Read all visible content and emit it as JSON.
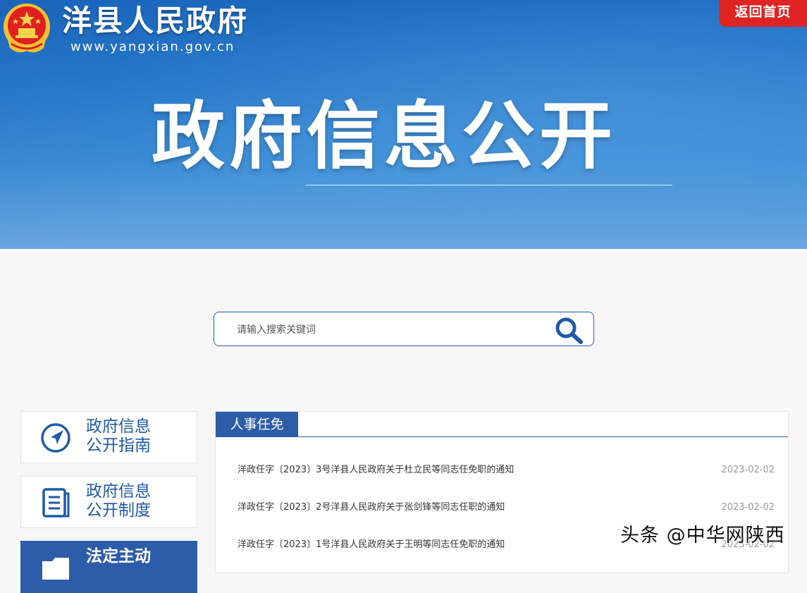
{
  "header": {
    "site_name": "洋县人民政府",
    "site_url": "www.yangxian.gov.cn",
    "home_button": "返回首页",
    "hero_title": "政府信息公开"
  },
  "search": {
    "placeholder": "请输入搜索关键词",
    "value": ""
  },
  "sidebar": {
    "items": [
      {
        "line1": "政府信息",
        "line2": "公开指南",
        "icon": "navigation-icon"
      },
      {
        "line1": "政府信息",
        "line2": "公开制度",
        "icon": "document-icon"
      },
      {
        "line1": "法定主动",
        "line2": "",
        "icon": "folder-icon"
      }
    ]
  },
  "panel": {
    "tab": "人事任免",
    "items": [
      {
        "title": "洋政任字〔2023〕3号洋县人民政府关于杜立民等同志任免职的通知",
        "date": "2023-02-02"
      },
      {
        "title": "洋政任字〔2023〕2号洋县人民政府关于张剑锋等同志任职的通知",
        "date": "2023-02-02"
      },
      {
        "title": "洋政任字〔2023〕1号洋县人民政府关于王明等同志任免职的通知",
        "date": "2023-02-02"
      }
    ]
  },
  "watermark": "头条 @中华网陕西",
  "colors": {
    "primary_blue": "#2d5da8",
    "home_red": "#e02323",
    "banner_blue": "#2a7fd0"
  }
}
